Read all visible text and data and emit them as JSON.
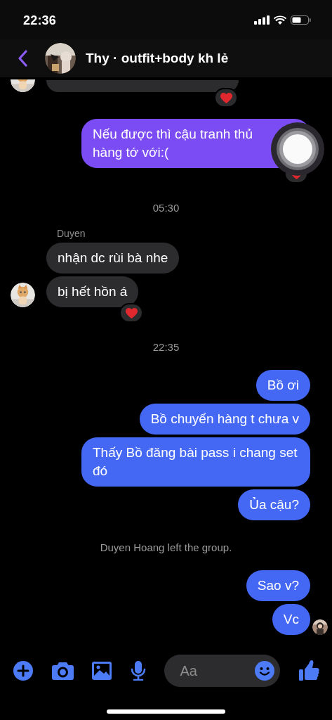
{
  "status_bar": {
    "time": "22:36"
  },
  "header": {
    "title": "Thy · outfit+body kh lẻ"
  },
  "messages": [
    {
      "kind": "fragment",
      "reaction": true,
      "avatar": true
    },
    {
      "kind": "message",
      "outgoing": true,
      "color": "#7b4cf3",
      "text": "Nếu được thì cậu tranh thủ\nhàng tớ với:(",
      "reaction": true
    },
    {
      "kind": "timestamp",
      "text": "05:30"
    },
    {
      "kind": "sender",
      "text": "Duyen"
    },
    {
      "kind": "message",
      "outgoing": false,
      "text": "nhận dc rùi bà nhe",
      "reaction": false,
      "avatar": false
    },
    {
      "kind": "message",
      "outgoing": false,
      "text": "bị hết hồn á",
      "reaction": true,
      "avatar": true
    },
    {
      "kind": "timestamp",
      "text": "22:35"
    },
    {
      "kind": "message",
      "outgoing": true,
      "color": "#4468f4",
      "text": "Bồ ơi",
      "reaction": false
    },
    {
      "kind": "message",
      "outgoing": true,
      "color": "#4468f4",
      "text": "Bồ chuyển hàng t chưa v",
      "reaction": false
    },
    {
      "kind": "message",
      "outgoing": true,
      "color": "#4468f4",
      "text": "Thấy Bồ đăng bài pass i chang set đó",
      "reaction": false
    },
    {
      "kind": "message",
      "outgoing": true,
      "color": "#4468f4",
      "text": "Ủa cậu?",
      "reaction": false
    },
    {
      "kind": "notice",
      "text": "Duyen Hoang left the group."
    },
    {
      "kind": "message",
      "outgoing": true,
      "color": "#4468f4",
      "text": "Sao v?",
      "reaction": false
    },
    {
      "kind": "message",
      "outgoing": true,
      "color": "#4468f4",
      "text": "Vc",
      "reaction": false,
      "seen": true
    }
  ],
  "composer": {
    "placeholder": "Aa"
  }
}
